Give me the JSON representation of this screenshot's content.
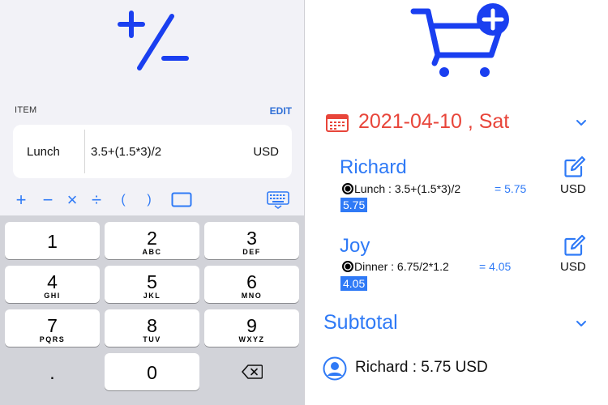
{
  "calculator": {
    "section_label": "ITEM",
    "edit_label": "EDIT",
    "item": {
      "name": "Lunch",
      "expression": "3.5+(1.5*3)/2",
      "currency": "USD"
    },
    "operators": [
      "+",
      "−",
      "×",
      "÷",
      "(",
      ")"
    ],
    "keys": [
      {
        "num": "1",
        "sub": ""
      },
      {
        "num": "2",
        "sub": "ABC"
      },
      {
        "num": "3",
        "sub": "DEF"
      },
      {
        "num": "4",
        "sub": "GHI"
      },
      {
        "num": "5",
        "sub": "JKL"
      },
      {
        "num": "6",
        "sub": "MNO"
      },
      {
        "num": "7",
        "sub": "PQRS"
      },
      {
        "num": "8",
        "sub": "TUV"
      },
      {
        "num": "9",
        "sub": "WXYZ"
      },
      {
        "num": ".",
        "sub": ""
      },
      {
        "num": "0",
        "sub": ""
      }
    ]
  },
  "summary": {
    "date": "2021-04-10 , Sat",
    "people": [
      {
        "name": "Richard",
        "item": "Lunch : 3.5+(1.5*3)/2",
        "result": "= 5.75",
        "total": "5.75",
        "currency": "USD"
      },
      {
        "name": "Joy",
        "item": "Dinner : 6.75/2*1.2",
        "result": "= 4.05",
        "total": "4.05",
        "currency": "USD"
      }
    ],
    "subtotal_label": "Subtotal",
    "subtotal_line": "Richard : 5.75 USD"
  },
  "colors": {
    "accent": "#2f7af6",
    "date": "#e8453a",
    "icon_blue": "#1a3ff0"
  }
}
